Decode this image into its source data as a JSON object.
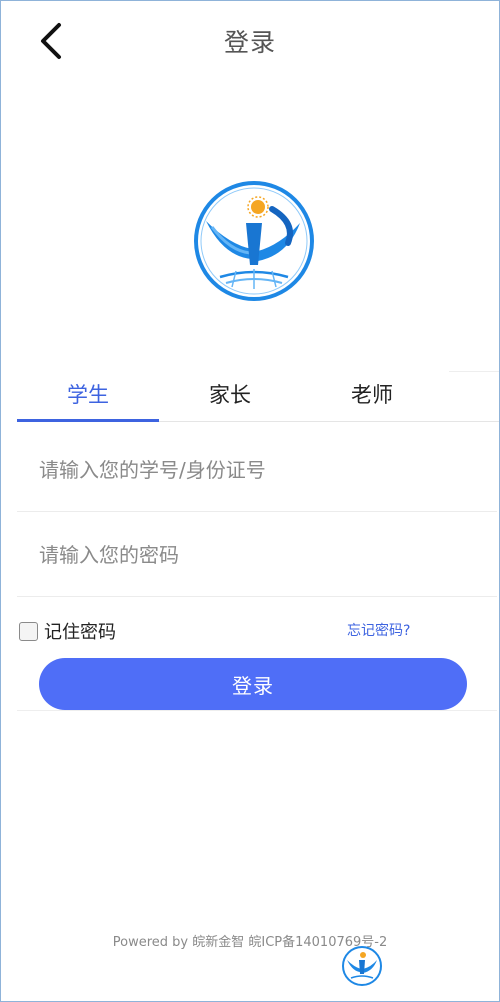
{
  "header": {
    "title": "登录",
    "back_icon": "chevron-left-icon"
  },
  "logo": {
    "icon": "app-logo",
    "colors": {
      "primary": "#1e88e5",
      "accent": "#f5a623"
    }
  },
  "tabs": [
    {
      "label": "学生",
      "active": true
    },
    {
      "label": "家长",
      "active": false
    },
    {
      "label": "老师",
      "active": false
    }
  ],
  "form": {
    "account_placeholder": "请输入您的学号/身份证号",
    "account_value": "",
    "password_placeholder": "请输入您的密码",
    "password_value": "",
    "remember_label": "记住密码",
    "remember_checked": false,
    "forgot_label": "忘记密码?",
    "login_label": "登录"
  },
  "footer": {
    "text": "Powered by 皖新金智 皖ICP备14010769号-2"
  },
  "colors": {
    "accent": "#3d63e0",
    "button": "#4f6ef7",
    "frame_border": "#8fb3d9"
  }
}
